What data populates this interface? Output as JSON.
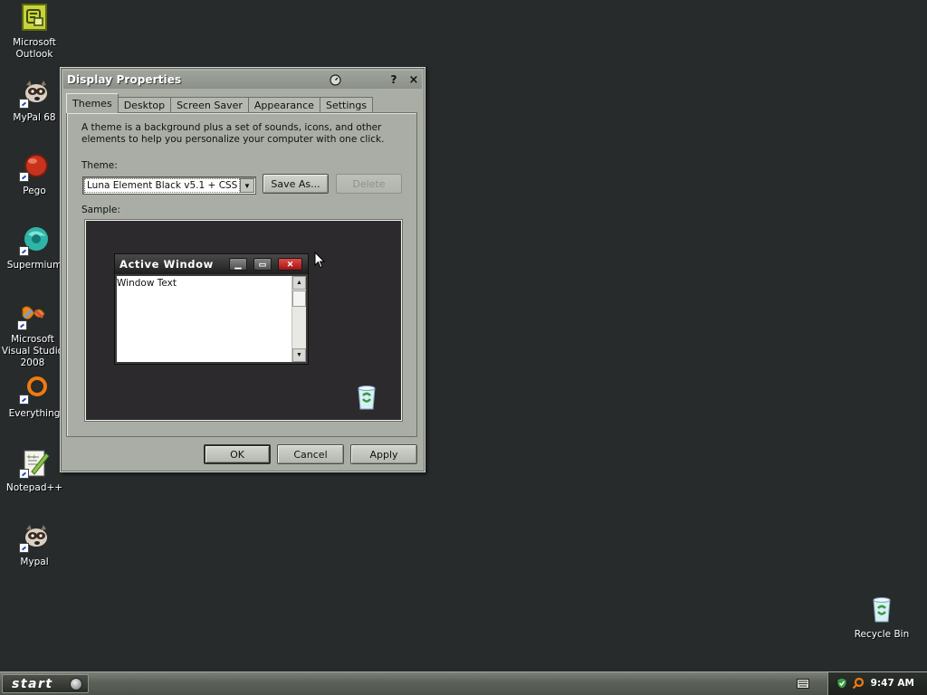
{
  "desktop": {
    "icons": [
      {
        "label": "Microsoft Outlook"
      },
      {
        "label": "MyPal 68"
      },
      {
        "label": "Pego"
      },
      {
        "label": "Supermium"
      },
      {
        "label": "Microsoft Visual Studio 2008"
      },
      {
        "label": "Everything"
      },
      {
        "label": "Notepad++"
      },
      {
        "label": "Mypal"
      },
      {
        "label": "Recycle Bin"
      }
    ]
  },
  "dialog": {
    "title": "Display Properties",
    "title_buttons": {
      "help": "?",
      "close": "×"
    },
    "tabs": [
      {
        "label": "Themes",
        "active": true
      },
      {
        "label": "Desktop"
      },
      {
        "label": "Screen Saver"
      },
      {
        "label": "Appearance"
      },
      {
        "label": "Settings"
      }
    ],
    "description": "A theme is a background plus a set of sounds, icons, and other elements to help you personalize your computer with one click.",
    "theme_label": "Theme:",
    "theme_value": "Luna Element Black v5.1 + CSS",
    "save_as_label": "Save As...",
    "delete_label": "Delete",
    "sample_label": "Sample:",
    "sample_window": {
      "title": "Active Window",
      "text": "Window Text"
    },
    "ok_label": "OK",
    "cancel_label": "Cancel",
    "apply_label": "Apply"
  },
  "taskbar": {
    "start_label": "start",
    "clock": "9:47 AM"
  },
  "colors": {
    "desktop_background": "#272b2b",
    "dialog_face": "#a9ada5",
    "sample_background": "#2d2a2d",
    "sample_close_button": "#c62828"
  }
}
